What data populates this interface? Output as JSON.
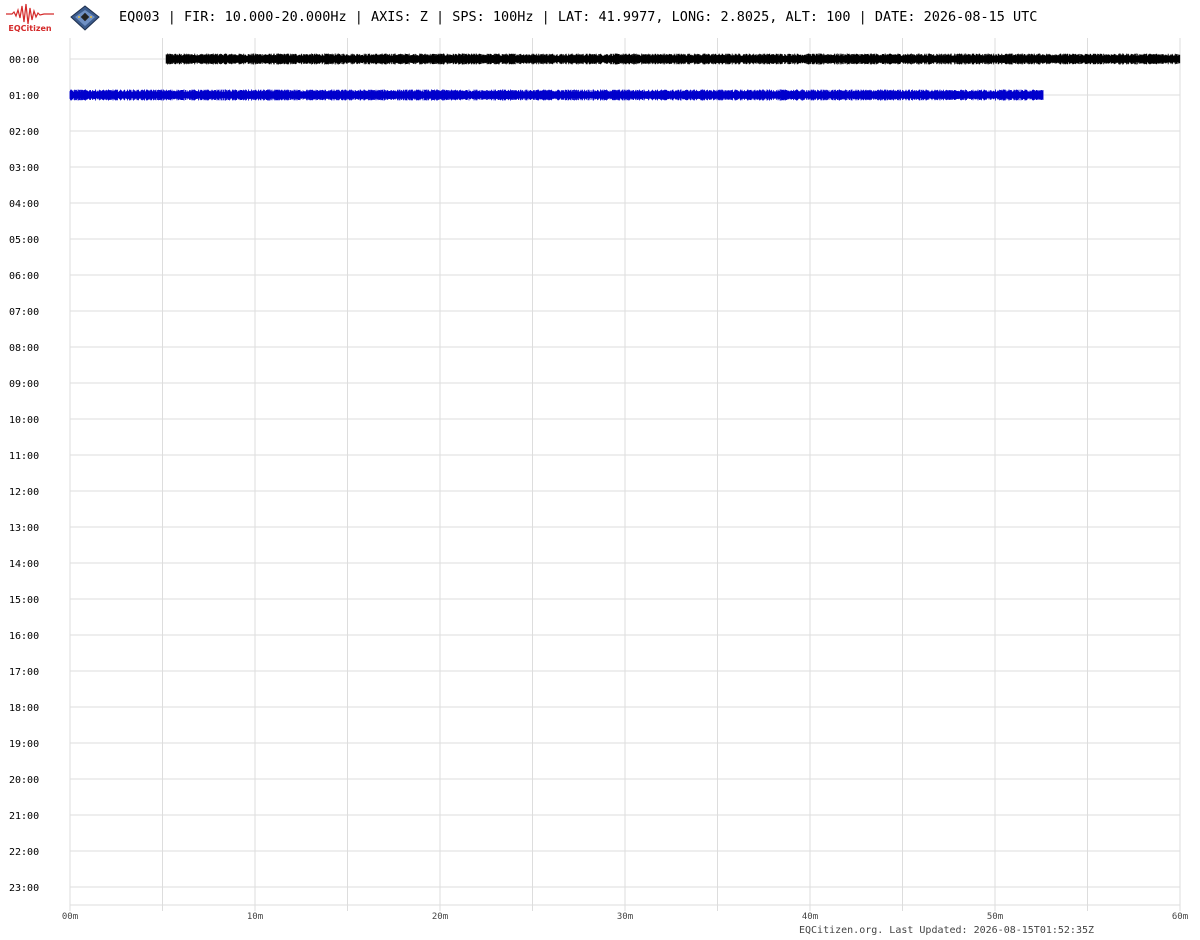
{
  "header": {
    "logo_text": "EQCitizen",
    "title": "EQ003 | FIR: 10.000-20.000Hz | AXIS: Z | SPS: 100Hz | LAT: 41.9977, LONG: 2.8025, ALT: 100 | DATE: 2026-08-15 UTC"
  },
  "footer": {
    "text": "EQCitizen.org. Last Updated: 2026-08-15T01:52:35Z"
  },
  "chart_data": {
    "type": "line",
    "title": "",
    "xlabel": "",
    "ylabel": "",
    "xlim": [
      0,
      60
    ],
    "grid": true,
    "y_ticks": [
      "00:00",
      "01:00",
      "02:00",
      "03:00",
      "04:00",
      "05:00",
      "06:00",
      "07:00",
      "08:00",
      "09:00",
      "10:00",
      "11:00",
      "12:00",
      "13:00",
      "14:00",
      "15:00",
      "16:00",
      "17:00",
      "18:00",
      "19:00",
      "20:00",
      "21:00",
      "22:00",
      "23:00"
    ],
    "x_ticks": [
      {
        "value": 0,
        "label": "00m"
      },
      {
        "value": 10,
        "label": "10m"
      },
      {
        "value": 20,
        "label": "20m"
      },
      {
        "value": 30,
        "label": "30m"
      },
      {
        "value": 40,
        "label": "40m"
      },
      {
        "value": 50,
        "label": "50m"
      },
      {
        "value": 60,
        "label": "60m"
      }
    ],
    "series": [
      {
        "row": "00:00",
        "start_minute": 5.2,
        "end_minute": 60,
        "color": "#000000"
      },
      {
        "row": "01:00",
        "start_minute": 0,
        "end_minute": 52.6,
        "color": "#0000cc"
      }
    ],
    "colors": {
      "grid": "#dddddd"
    }
  }
}
